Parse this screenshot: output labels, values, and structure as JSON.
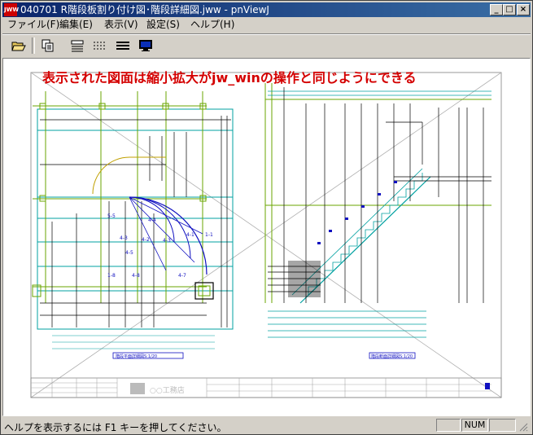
{
  "window": {
    "title": "040701 R階段板割り付け図･階段詳細図.jww - pnViewJ",
    "icon_label": "JWW",
    "controls": [
      "_",
      "□",
      "×"
    ]
  },
  "menu": {
    "items": [
      {
        "label": "ファイル(F)"
      },
      {
        "label": "編集(E)"
      },
      {
        "label": "表示(V)"
      },
      {
        "label": "設定(S)"
      },
      {
        "label": "ヘルプ(H)"
      }
    ]
  },
  "toolbar": {
    "tools": [
      {
        "name": "open-icon"
      },
      {
        "name": "copy-icon"
      },
      {
        "name": "layers-icon"
      },
      {
        "name": "dotted-lines-icon"
      },
      {
        "name": "lines-icon"
      },
      {
        "name": "monitor-icon"
      }
    ]
  },
  "canvas": {
    "overlay_text": "表示された図面は縮小拡大がjw_winの操作と同じようにできる",
    "overlay_color": "#d40000",
    "plan_label": "階段平面詳細図S:1/20",
    "section_label": "階段断面詳細図S:1/20",
    "company_label": "○○工務店"
  },
  "status": {
    "help_text": "ヘルプを表示するには F1 キーを押してください。",
    "num_label": "NUM"
  }
}
